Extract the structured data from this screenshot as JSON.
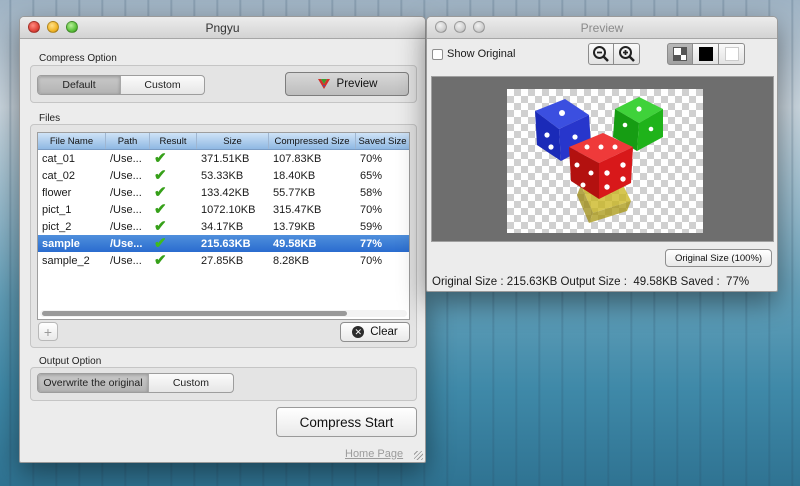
{
  "main_window": {
    "title": "Pngyu",
    "compress_option": {
      "label": "Compress Option",
      "segments": [
        "Default",
        "Custom"
      ],
      "selected": "Default",
      "preview_button": "Preview"
    },
    "files": {
      "label": "Files",
      "columns": [
        "File Name",
        "Path",
        "Result",
        "Size",
        "Compressed Size",
        "Saved Size"
      ],
      "rows": [
        {
          "name": "cat_01",
          "path": "/Use...",
          "result": "✔",
          "size": "371.51KB",
          "compressed": "107.83KB",
          "saved": "70%"
        },
        {
          "name": "cat_02",
          "path": "/Use...",
          "result": "✔",
          "size": "53.33KB",
          "compressed": "18.40KB",
          "saved": "65%"
        },
        {
          "name": "flower",
          "path": "/Use...",
          "result": "✔",
          "size": "133.42KB",
          "compressed": "55.77KB",
          "saved": "58%"
        },
        {
          "name": "pict_1",
          "path": "/Use...",
          "result": "✔",
          "size": "1072.10KB",
          "compressed": "315.47KB",
          "saved": "70%"
        },
        {
          "name": "pict_2",
          "path": "/Use...",
          "result": "✔",
          "size": "34.17KB",
          "compressed": "13.79KB",
          "saved": "59%"
        },
        {
          "name": "sample",
          "path": "/Use...",
          "result": "✔",
          "size": "215.63KB",
          "compressed": "49.58KB",
          "saved": "77%"
        },
        {
          "name": "sample_2",
          "path": "/Use...",
          "result": "✔",
          "size": "27.85KB",
          "compressed": "8.28KB",
          "saved": "70%"
        }
      ],
      "selected_row": "sample",
      "add_button": "+",
      "clear_button": "Clear"
    },
    "output_option": {
      "label": "Output Option",
      "segments": [
        "Overwrite the original",
        "Custom"
      ],
      "selected": "Overwrite the original"
    },
    "compress_start_button": "Compress Start",
    "home_page_link": "Home Page"
  },
  "preview_window": {
    "title": "Preview",
    "show_original_label": "Show Original",
    "show_original_checked": false,
    "zoom_out_icon": "zoom-out-icon",
    "zoom_in_icon": "zoom-in-icon",
    "background_options": [
      "checkerboard",
      "black",
      "white"
    ],
    "selected_background": "checkerboard",
    "original_size_button": "Original Size (100%)",
    "status": "Original Size : 215.63KB Output Size :  49.58KB Saved :  77%"
  },
  "colors": {
    "selection": "#2a6ccf",
    "check": "#36a019",
    "dice_red": "#d8181a",
    "dice_blue": "#1f34c8",
    "dice_green": "#1fb31a",
    "dice_yellow": "#d8c21a"
  }
}
